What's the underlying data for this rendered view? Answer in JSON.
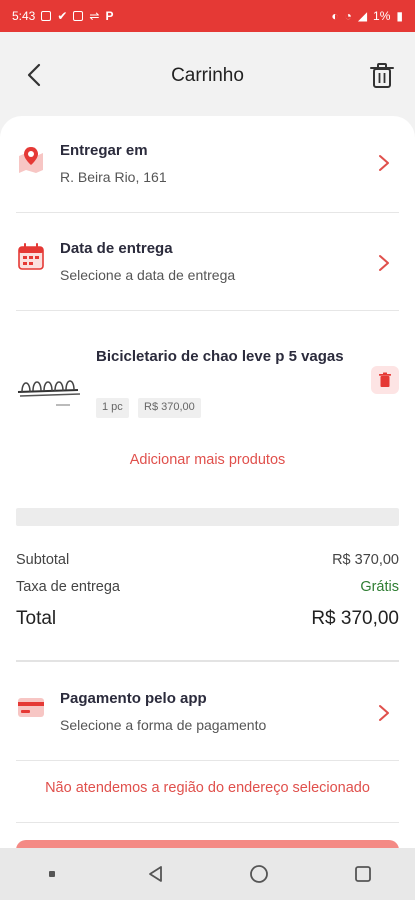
{
  "status_bar": {
    "time": "5:43",
    "battery": "1%",
    "color": "#e53935"
  },
  "header": {
    "title": "Carrinho",
    "back_icon": "chevron-left-icon",
    "trash_icon": "trash-icon"
  },
  "delivery_address": {
    "title": "Entregar em",
    "value": "R. Beira Rio, 161",
    "icon": "map-pin-icon"
  },
  "delivery_date": {
    "title": "Data de entrega",
    "value": "Selecione a data de entrega",
    "icon": "calendar-icon"
  },
  "product": {
    "name": "Bicicletario de chao leve p 5 vagas",
    "quantity": "1 pc",
    "price": "R$ 370,00"
  },
  "add_more_label": "Adicionar mais produtos",
  "summary": {
    "subtotal_label": "Subtotal",
    "subtotal_value": "R$ 370,00",
    "delivery_fee_label": "Taxa de entrega",
    "delivery_fee_value": "Grátis",
    "total_label": "Total",
    "total_value": "R$ 370,00"
  },
  "payment": {
    "title": "Pagamento pelo app",
    "value": "Selecione a forma de pagamento",
    "icon": "credit-card-icon"
  },
  "warning_message": "Não atendemos a região do endereço selecionado",
  "colors": {
    "accent": "#e0504c",
    "free": "#2e7d32"
  }
}
